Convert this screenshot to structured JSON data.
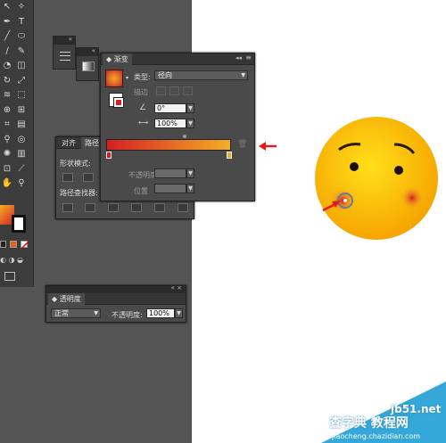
{
  "gradient_panel": {
    "tab": "渐变",
    "type_label": "类型:",
    "type_value": "径向",
    "stroke_label": "描边",
    "angle_value": "0°",
    "ratio_value": "100%",
    "opacity_label": "不透明度",
    "location_label": "位置",
    "gradient_start": "#d41f23",
    "gradient_end": "#f3ae27"
  },
  "align_panel": {
    "tab_align": "对齐",
    "tab_pathfinder": "路径",
    "shape_modes_label": "形状模式:",
    "pathfinder_label": "路径查找器:"
  },
  "transparency_panel": {
    "tab": "透明度",
    "blend_mode": "正常",
    "opacity_label": "不透明度:",
    "opacity_value": "100%"
  },
  "watermark": {
    "site_cn": "查字典 教程网",
    "site_en": "jb51.net",
    "url": "jiaocheng.chazidian.com"
  },
  "colors": {
    "panel_bg": "#4a4a4a",
    "workspace_bg": "#545454",
    "arrow": "#e31b1b",
    "face_center": "#ffe01a",
    "face_edge": "#f6a400"
  }
}
